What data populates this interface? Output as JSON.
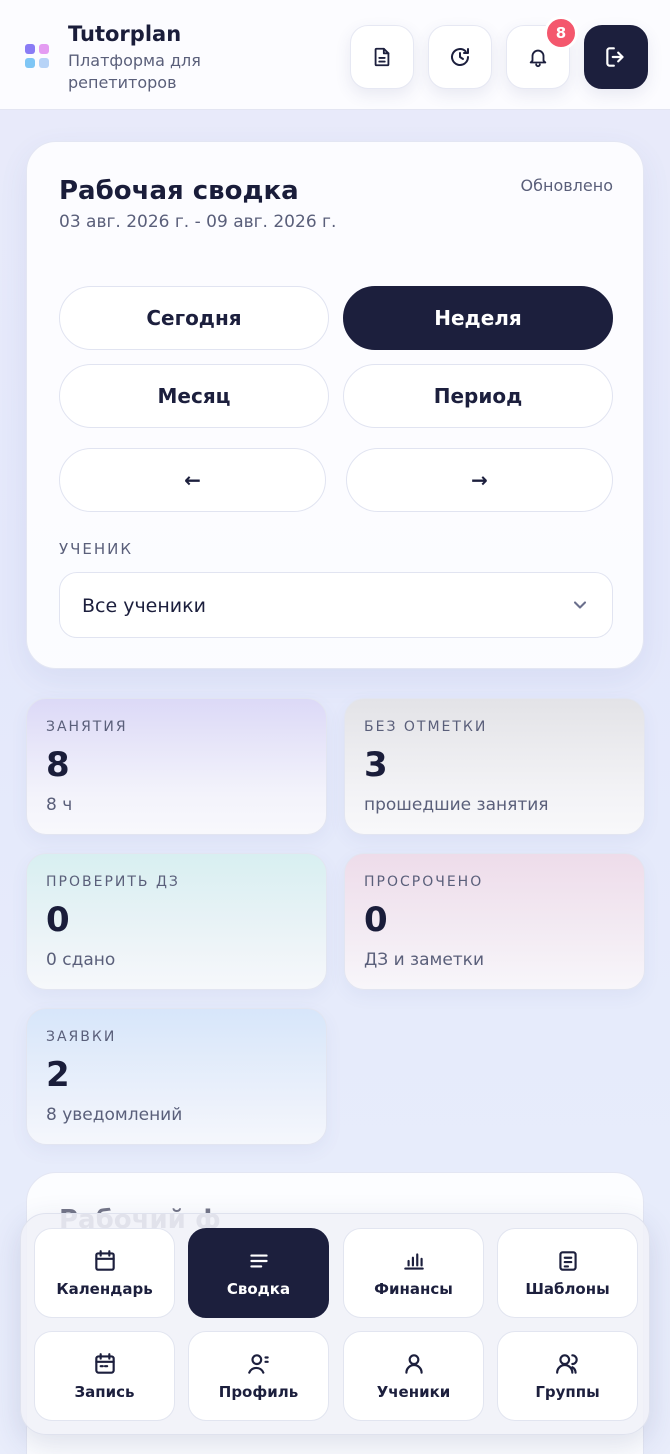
{
  "header": {
    "brand_title": "Tutorplan",
    "brand_subtitle": "Платформа для репетиторов",
    "notifications_count": "8"
  },
  "summary": {
    "title": "Рабочая сводка",
    "updated": "Обновлено",
    "date_range": "03 авг. 2026 г. - 09 авг. 2026 г.",
    "periods": [
      "Сегодня",
      "Неделя",
      "Месяц",
      "Период"
    ],
    "active_period": "Неделя",
    "prev_label": "←",
    "next_label": "→",
    "student_label": "УЧЕНИК",
    "student_value": "Все ученики"
  },
  "stats": [
    {
      "label": "ЗАНЯТИЯ",
      "value": "8",
      "sub": "8 ч"
    },
    {
      "label": "БЕЗ ОТМЕТКИ",
      "value": "3",
      "sub": "прошедшие занятия"
    },
    {
      "label": "ПРОВЕРИТЬ ДЗ",
      "value": "0",
      "sub": "0 сдано"
    },
    {
      "label": "ПРОСРОЧЕНО",
      "value": "0",
      "sub": "ДЗ и заметки"
    },
    {
      "label": "ЗАЯВКИ",
      "value": "2",
      "sub": "8 уведомлений"
    }
  ],
  "card2": {
    "title": "Рабочий ф"
  },
  "nav": [
    {
      "label": "Календарь",
      "icon": "calendar-icon"
    },
    {
      "label": "Сводка",
      "icon": "summary-icon",
      "active": true
    },
    {
      "label": "Финансы",
      "icon": "chart-icon"
    },
    {
      "label": "Шаблоны",
      "icon": "template-icon"
    },
    {
      "label": "Запись",
      "icon": "booking-icon"
    },
    {
      "label": "Профиль",
      "icon": "profile-icon"
    },
    {
      "label": "Ученики",
      "icon": "student-icon"
    },
    {
      "label": "Группы",
      "icon": "group-icon"
    }
  ],
  "colors": {
    "primary_dark": "#1c1f3d",
    "badge": "#f4576d"
  }
}
